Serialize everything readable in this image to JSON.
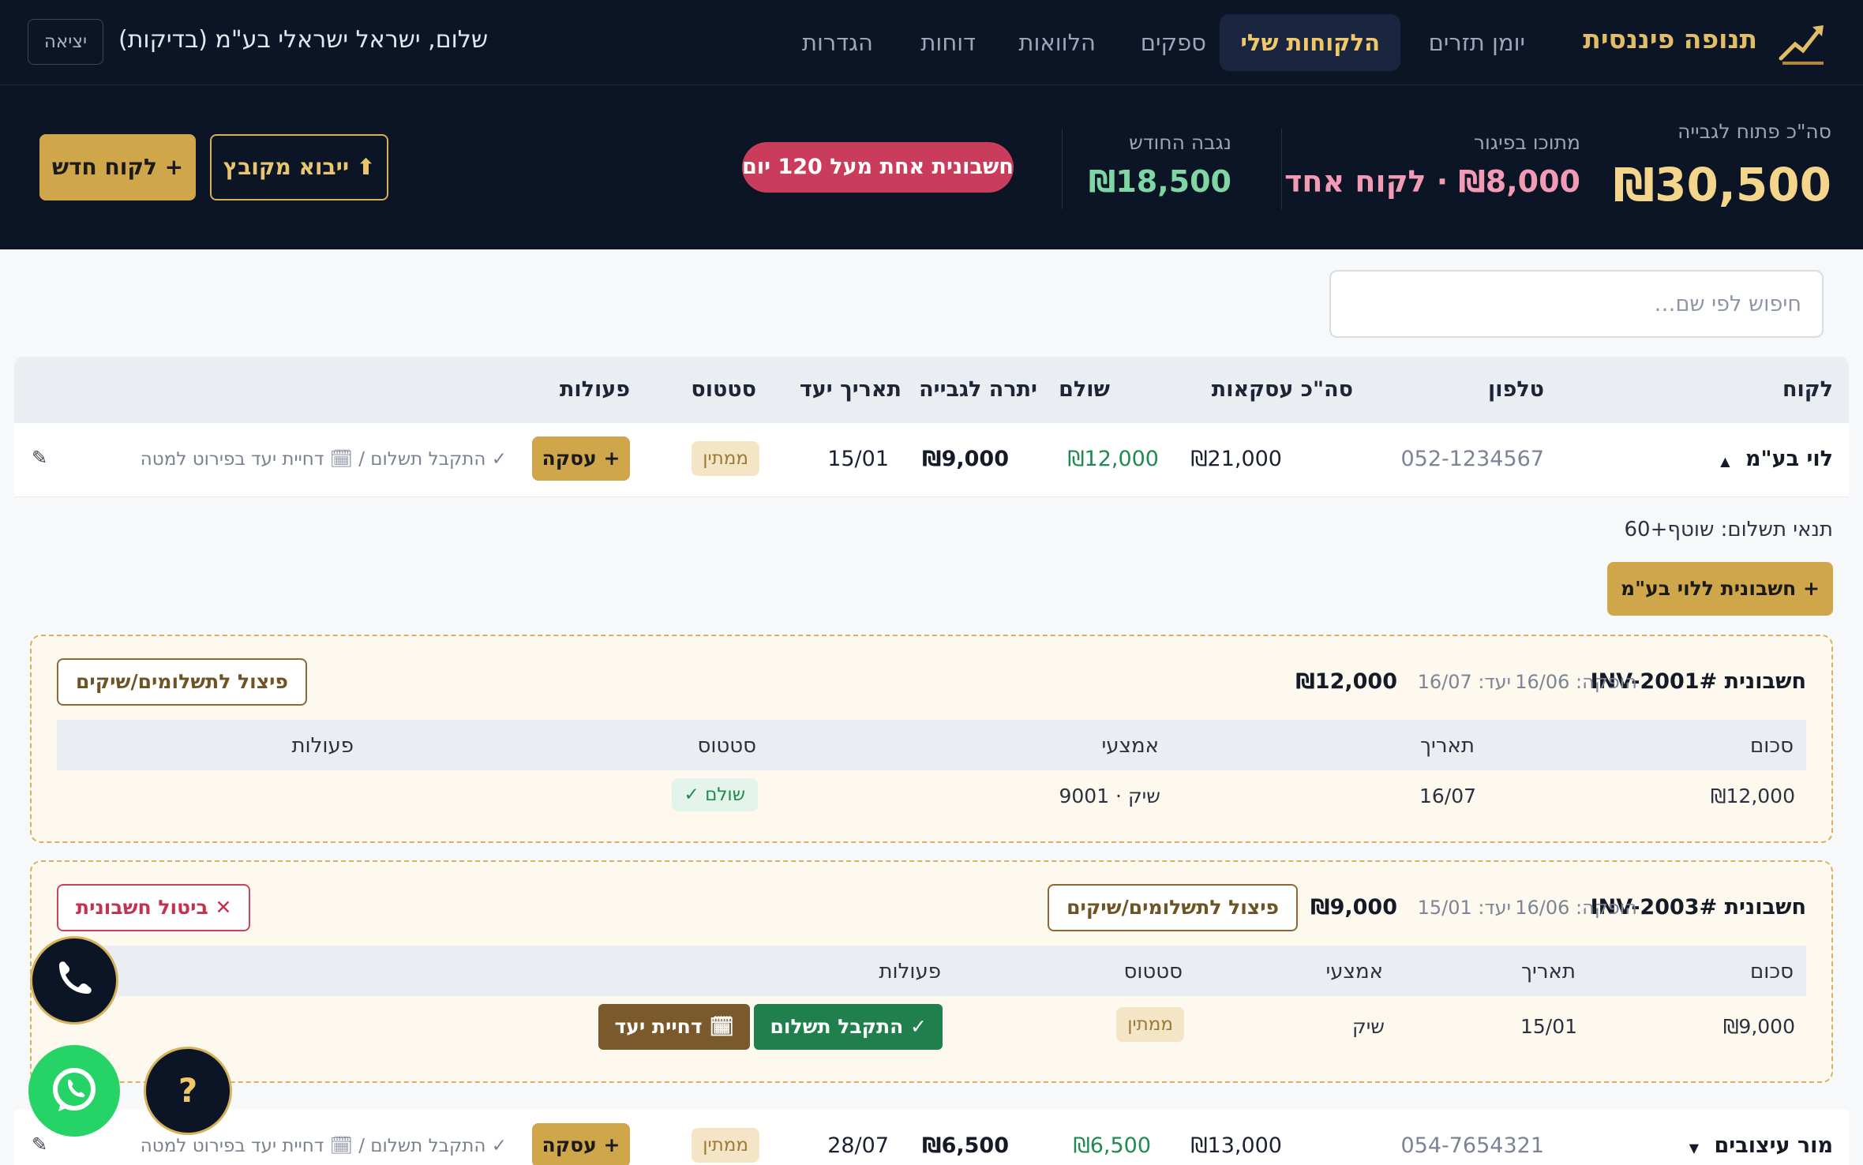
{
  "nav": {
    "brand": "תנופה פיננסית",
    "items": [
      "יומן תזרים",
      "הלקוחות שלי",
      "ספקים",
      "הלוואות",
      "דוחות",
      "הגדרות"
    ],
    "greeting": "שלום, ישראל ישראלי בע\"מ (בדיקות)",
    "logout": "יציאה"
  },
  "summary": {
    "total_label": "סה\"כ פתוח לגבייה",
    "total_value": "₪30,500",
    "overdue_label": "מתוכו בפיגור",
    "overdue_value": "₪8,000 · לקוח אחד",
    "collected_label": "נגבה החודש",
    "collected_value": "₪18,500",
    "alert": "חשבונית אחת מעל 120 יום",
    "import_label": "⬆ ייבוא מקובץ",
    "new_client_label": "+ לקוח חדש"
  },
  "search": {
    "placeholder": "חיפוש לפי שם…"
  },
  "table": {
    "headers": [
      "לקוח",
      "טלפון",
      "סה\"כ עסקאות",
      "שולם",
      "יתרה לגבייה",
      "תאריך יעד",
      "סטטוס",
      "פעולות"
    ],
    "rows": [
      {
        "name": "לוי בע\"מ",
        "caret": "▲",
        "phone": "052-1234567",
        "total": "₪21,000",
        "paid": "₪12,000",
        "balance": "₪9,000",
        "due": "15/01",
        "status": "ממתין",
        "deal_label": "+ עסקה",
        "hint": "✓ התקבל תשלום / 🗓 דחיית יעד בפירוט למטה"
      },
      {
        "name": "מור עיצובים",
        "caret": "▼",
        "phone": "054-7654321",
        "total": "₪13,000",
        "paid": "₪6,500",
        "balance": "₪6,500",
        "due": "28/07",
        "status": "ממתין",
        "deal_label": "+ עסקה",
        "hint": "✓ התקבל תשלום / 🗓 דחיית יעד בפירוט למטה"
      }
    ]
  },
  "expanded": {
    "terms": "תנאי תשלום: שוטף+60",
    "add_invoice_label": "+ חשבונית ללוי בע\"מ",
    "invoices": [
      {
        "title": "חשבונית #INV-2001",
        "issued": "הופקה: 16/06",
        "due": "יעד: 16/07",
        "amount": "₪12,000",
        "split_label": "פיצול לתשלומים/שיקים",
        "headers": [
          "סכום",
          "תאריך",
          "אמצעי",
          "סטטוס",
          "פעולות"
        ],
        "payment": {
          "amount": "₪12,000",
          "date": "16/07",
          "method": "שיק · 9001",
          "status": "שולם ✓"
        }
      },
      {
        "title": "חשבונית #INV-2003",
        "issued": "הופקה: 16/06",
        "due": "יעד: 15/01",
        "amount": "₪9,000",
        "split_label": "פיצול לתשלומים/שיקים",
        "cancel_label": "ביטול חשבונית",
        "headers": [
          "סכום",
          "תאריך",
          "אמצעי",
          "סטטוס",
          "פעולות"
        ],
        "payment": {
          "amount": "₪9,000",
          "date": "15/01",
          "method": "שיק",
          "status": "ממתין",
          "received_label": "✓ התקבל תשלום",
          "defer_label": "🗓 דחיית יעד"
        }
      }
    ]
  },
  "fabs": {
    "help": "?"
  },
  "colors": {
    "navy": "#0c1526",
    "gold": "#cfa64a",
    "overdue_pink": "#f39ab4",
    "collected_green": "#7fd6a4",
    "alert_red": "#c93c5b"
  }
}
